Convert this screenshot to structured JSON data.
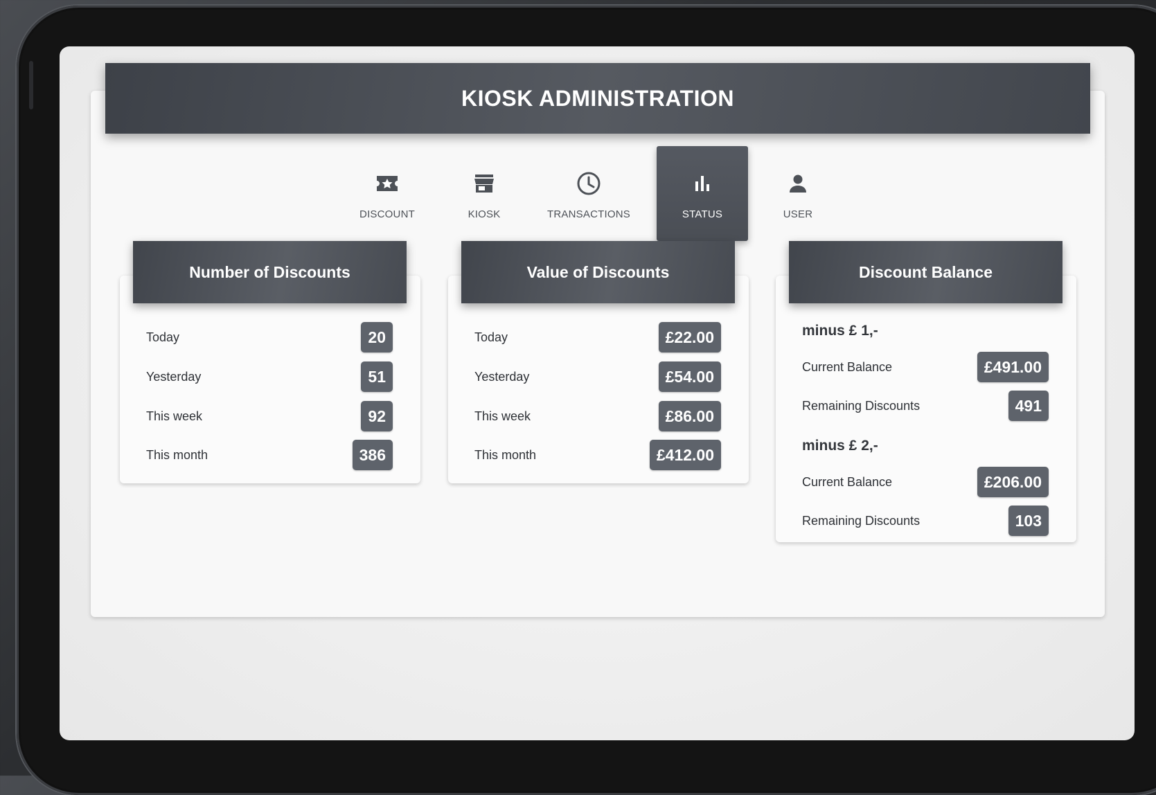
{
  "header": {
    "title": "KIOSK ADMINISTRATION"
  },
  "nav": {
    "tabs": [
      {
        "label": "DISCOUNT",
        "icon": "ticket-star-icon"
      },
      {
        "label": "KIOSK",
        "icon": "store-icon"
      },
      {
        "label": "TRANSACTIONS",
        "icon": "clock-icon"
      },
      {
        "label": "STATUS",
        "icon": "bar-chart-icon",
        "active": true
      },
      {
        "label": "USER",
        "icon": "person-icon"
      }
    ]
  },
  "cards": {
    "number": {
      "title": "Number of Discounts",
      "rows": [
        {
          "label": "Today",
          "value": "20"
        },
        {
          "label": "Yesterday",
          "value": "51"
        },
        {
          "label": "This week",
          "value": "92"
        },
        {
          "label": "This month",
          "value": "386"
        }
      ]
    },
    "value": {
      "title": "Value of Discounts",
      "rows": [
        {
          "label": "Today",
          "value": "£22.00"
        },
        {
          "label": "Yesterday",
          "value": "£54.00"
        },
        {
          "label": "This week",
          "value": "£86.00"
        },
        {
          "label": "This month",
          "value": "£412.00"
        }
      ]
    },
    "balance": {
      "title": "Discount Balance",
      "groups": [
        {
          "heading": "minus £ 1,-",
          "rows": [
            {
              "label": "Current Balance",
              "value": "£491.00"
            },
            {
              "label": "Remaining Discounts",
              "value": "491"
            }
          ]
        },
        {
          "heading": "minus £ 2,-",
          "rows": [
            {
              "label": "Current Balance",
              "value": "£206.00"
            },
            {
              "label": "Remaining Discounts",
              "value": "103"
            }
          ]
        }
      ]
    }
  },
  "colors": {
    "header_bg": "#4a4e55",
    "active_tab_bg": "#4e5259",
    "badge_bg": "#5e636b",
    "screen_bg": "#eeeeee"
  }
}
